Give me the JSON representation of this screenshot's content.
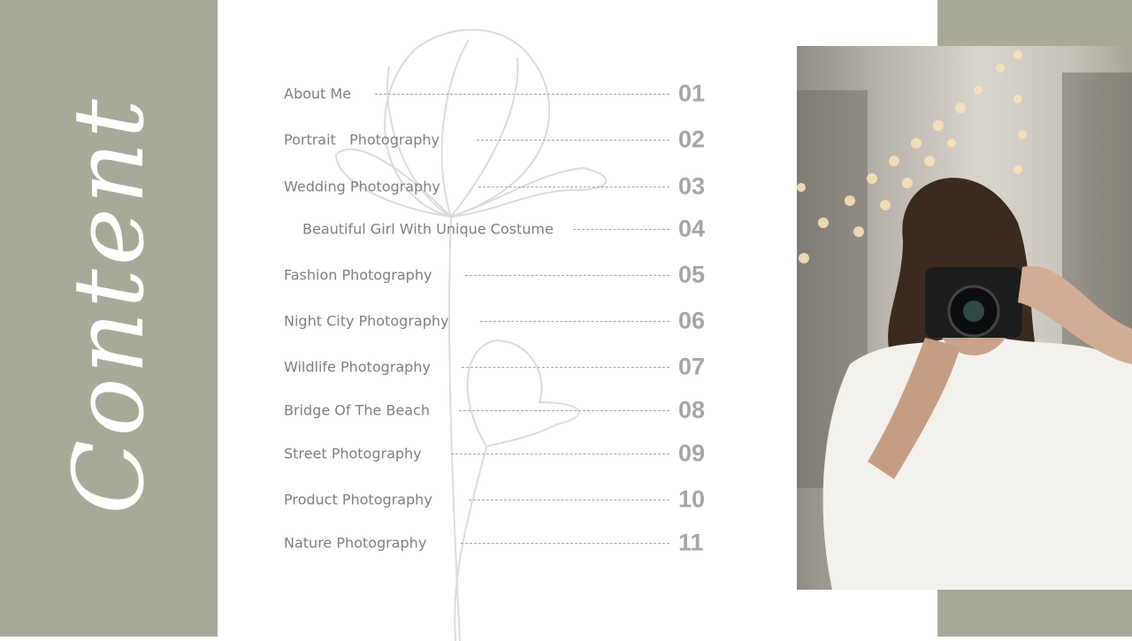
{
  "slide": {
    "title": "Content",
    "items": [
      {
        "label": "About Me",
        "number": "01"
      },
      {
        "label": "Portrait   Photography",
        "number": "02"
      },
      {
        "label": "Wedding Photography",
        "number": "03"
      },
      {
        "label": "Beautiful Girl With Unique Costume",
        "number": "04"
      },
      {
        "label": "Fashion Photography",
        "number": "05"
      },
      {
        "label": "Night City Photography",
        "number": "06"
      },
      {
        "label": "Wildlife Photography",
        "number": "07"
      },
      {
        "label": "Bridge Of The Beach",
        "number": "08"
      },
      {
        "label": "Street Photography",
        "number": "09"
      },
      {
        "label": "Product Photography",
        "number": "10"
      },
      {
        "label": "Nature Photography",
        "number": "11"
      }
    ],
    "colors": {
      "band": "#a9a999",
      "text": "#7f7f7f",
      "number": "#a6a6a6"
    },
    "photo_icon": "woman-with-camera-photo"
  }
}
